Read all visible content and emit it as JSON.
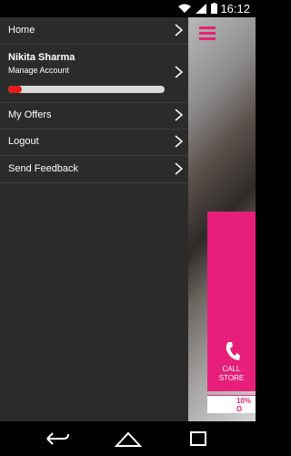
{
  "status_bar": {
    "time": "16:12",
    "icons": [
      "wifi-icon",
      "signal-icon",
      "battery-icon"
    ]
  },
  "drawer": {
    "items": [
      {
        "label": "Home"
      },
      {
        "label": "My Offers"
      },
      {
        "label": "Logout"
      },
      {
        "label": "Send Feedback"
      }
    ],
    "profile": {
      "name": "Nikita Sharma",
      "subtitle": "Manage Account",
      "progress": 0.09
    }
  },
  "background": {
    "call_label_1": "CALL",
    "call_label_2": "STORE",
    "offer_text": "10% O"
  },
  "colors": {
    "accent": "#e81f7a",
    "drawer_bg": "#2b2b2b",
    "progress": "#e41b17"
  },
  "nav_bar": {
    "icons": [
      "back-icon",
      "home-icon",
      "recents-icon"
    ]
  }
}
